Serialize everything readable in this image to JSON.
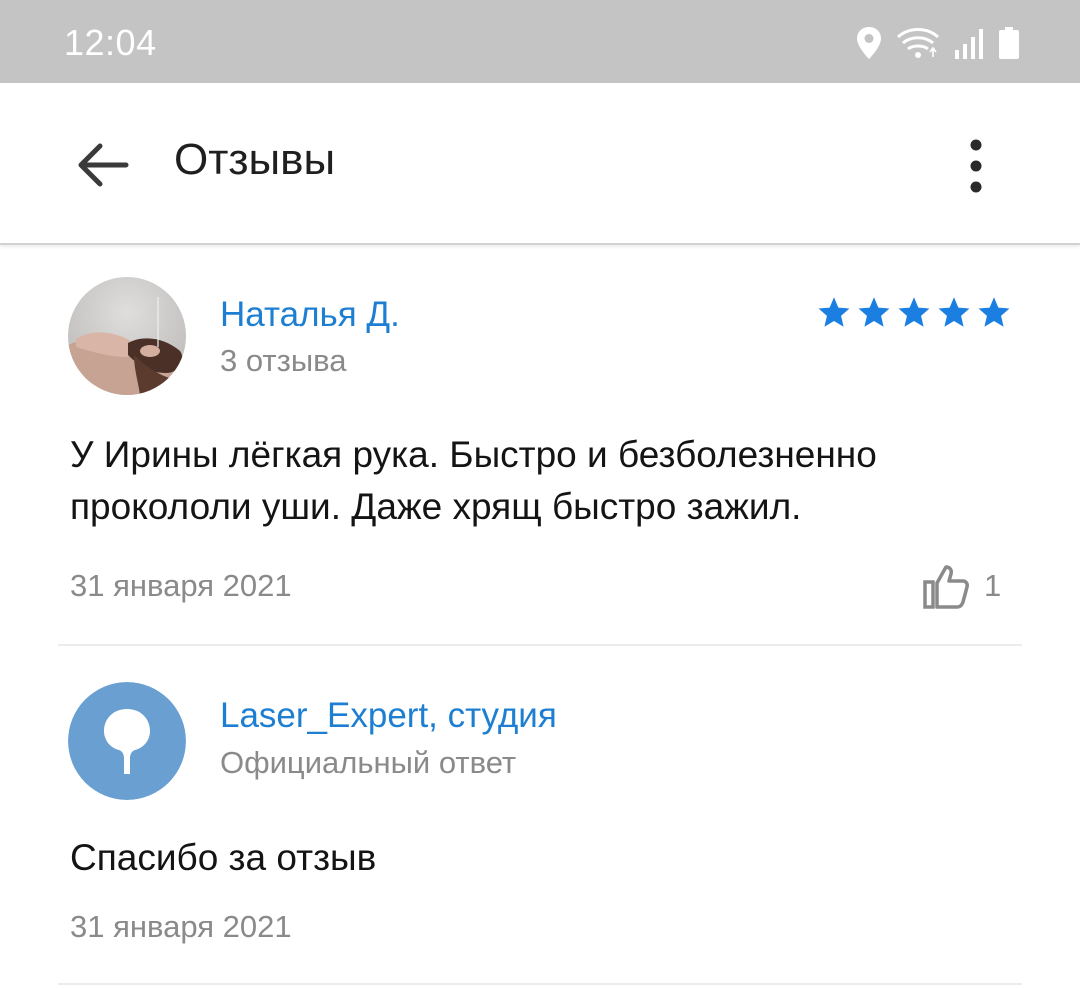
{
  "status_bar": {
    "time": "12:04",
    "icons": [
      "location-icon",
      "wifi-icon",
      "signal-icon",
      "battery-icon"
    ]
  },
  "app_bar": {
    "title": "Отзывы",
    "back_icon": "arrow-left-icon",
    "more_icon": "more-vertical-icon"
  },
  "reviews": [
    {
      "author": "Наталья Д.",
      "subtitle": "3 отзыва",
      "rating": 5,
      "text": "У Ирины лёгкая рука. Быстро и безболезненно прокололи уши. Даже хрящ быстро зажил.",
      "date": "31 января 2021",
      "likes": "1"
    },
    {
      "author": "Laser_Expert, студия",
      "subtitle": "Официальный ответ",
      "text": "Спасибо за отзыв",
      "date": "31 января 2021"
    }
  ],
  "colors": {
    "accent": "#1e7fd2",
    "star": "#1a7fe0",
    "studio_avatar": "#6a9fd1",
    "status_bar": "#c4c4c4"
  }
}
